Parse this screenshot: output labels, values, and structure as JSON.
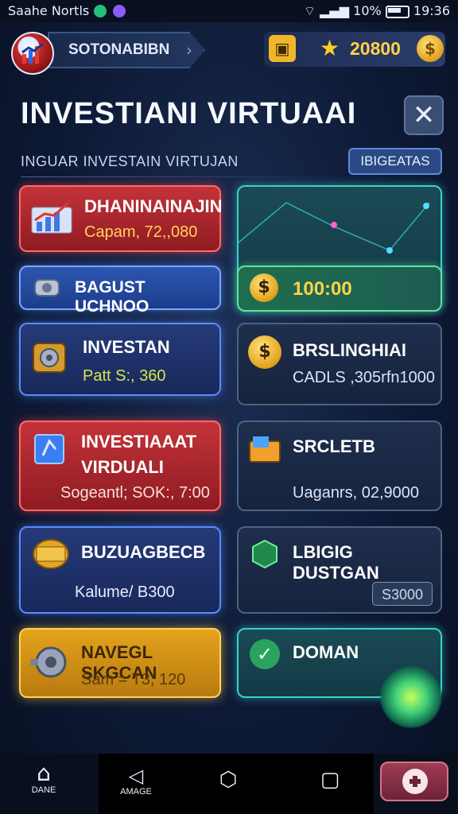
{
  "status_bar": {
    "left_text": "Saahe Nortls",
    "signal_text": "10%",
    "time": "19:36"
  },
  "header": {
    "player_name": "SOTONABIBN",
    "score": "20800",
    "coin_symbol": "$"
  },
  "title": "INVESTIANI VIRTUAAI",
  "subtitle": "INGUAR INVESTAIN VIRTUJAN",
  "top_button": "IBIGEATAS",
  "close_symbol": "✕",
  "cards": {
    "left": [
      {
        "title": "DHANINAINAJIN",
        "sub": "Capam, 72,,080",
        "color": "red"
      },
      {
        "title": "BAGUST UCHNOO",
        "sub": "",
        "color": "blue2"
      },
      {
        "title": "INVESTAN",
        "sub": "Patt S:, 360",
        "color": "blue"
      },
      {
        "title": "INVESTIAAAT",
        "title2": "VIRDUALI",
        "sub": "Sogeantl; SOK:, 7:00",
        "color": "red"
      },
      {
        "title": "BUZUAGBECB",
        "sub": "Kalume/ B300",
        "color": "blue"
      },
      {
        "title": "NAVEGL SKGCAN",
        "sub": "Sam = T3, 120",
        "color": "gold"
      }
    ],
    "right": [
      {
        "title": "",
        "value": "100:00",
        "coin": "$"
      },
      {
        "title": "BRSLINGHIAI",
        "sub": "CADLS ,305rfn1000"
      },
      {
        "title": "SRCLETB",
        "sub": "Uaganrs, 02,9000"
      },
      {
        "title": "LBIGIG DUSTGAN",
        "sub": "S3000"
      },
      {
        "title": "DOMAN",
        "sub": ""
      }
    ]
  },
  "nav": {
    "home_label": "DANE",
    "second_label": "AMAGE"
  }
}
